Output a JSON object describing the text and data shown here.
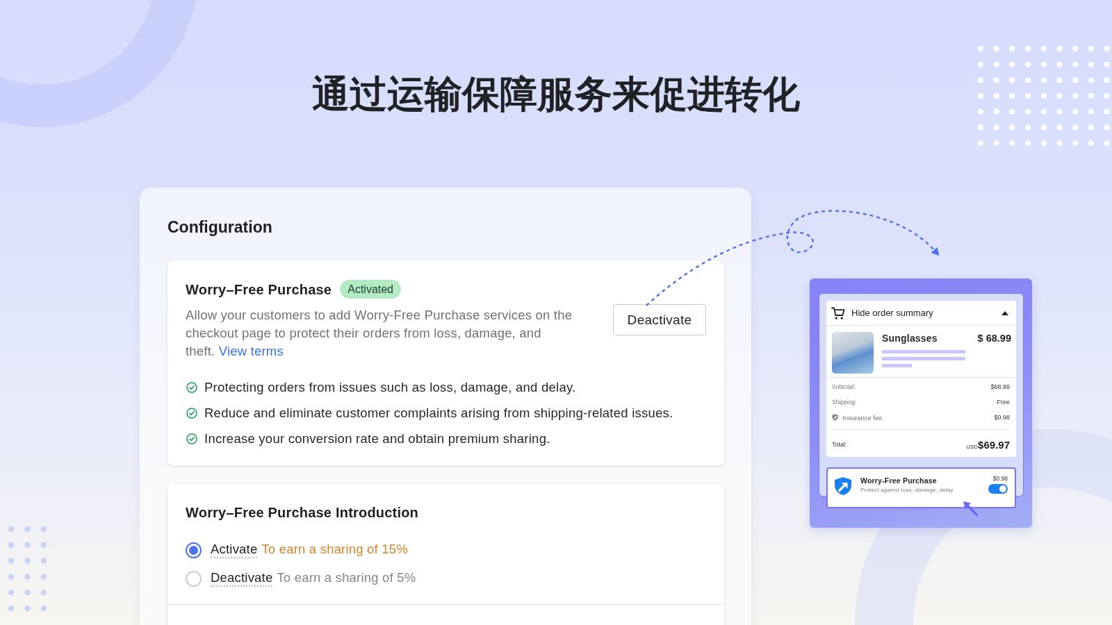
{
  "heading": "通过运输保障服务来促进转化",
  "configuration": {
    "title": "Configuration",
    "service_card": {
      "title": "Worry–Free Purchase",
      "badge": "Activated",
      "description_lines": [
        "Allow your customers to add Worry-Free Purchase services on the",
        "checkout page to protect their orders from loss, damage, and",
        "theft."
      ],
      "link": "View terms",
      "button": "Deactivate",
      "benefits": [
        "Protecting orders from issues such as loss, damage, and delay.",
        "Reduce and eliminate customer complaints arising from shipping-related issues.",
        "Increase your conversion rate and obtain premium sharing."
      ]
    },
    "introduction_card": {
      "title": "Worry–Free Purchase Introduction",
      "options": [
        {
          "label": "Activate",
          "note": "To earn a sharing of 15%",
          "selected": true
        },
        {
          "label": "Deactivate",
          "note": "To earn a sharing of 5%",
          "selected": false
        }
      ]
    }
  },
  "checkout_preview": {
    "summary_toggle": "Hide order summary",
    "expanded": true,
    "product": {
      "name": "Sunglasses",
      "price": "$ 68.99"
    },
    "lines": [
      {
        "kind": "plain",
        "label": "Subtotal:",
        "value": "$68.99"
      },
      {
        "kind": "plain",
        "label": "Shipping:",
        "value": "Free"
      },
      {
        "kind": "insurance",
        "label": "Insurance fee",
        "value": "$0.98"
      }
    ],
    "total": {
      "label": "Total:",
      "currency": "USD",
      "amount": "$69.97"
    },
    "protection_widget": {
      "title": "Worry-Free Purchase",
      "subtitle": "Protect against loss, damage, delay",
      "price": "$0.98",
      "on": true
    }
  }
}
